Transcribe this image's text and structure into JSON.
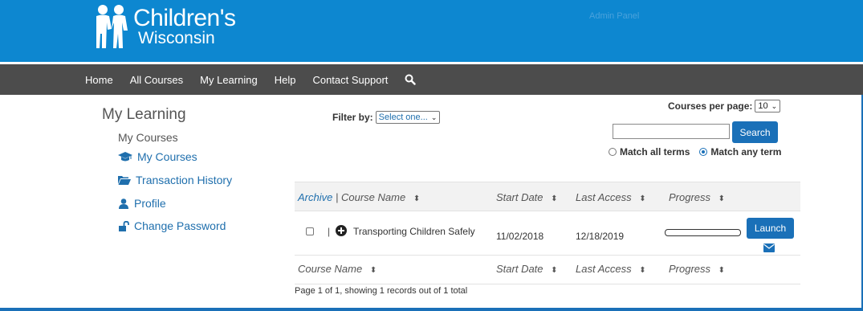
{
  "header": {
    "logo_line1": "Children's",
    "logo_line2": "Wisconsin",
    "admin_panel": "Admin Panel"
  },
  "nav": {
    "items": [
      "Home",
      "All Courses",
      "My Learning",
      "Help",
      "Contact Support"
    ],
    "search_icon": "search-icon"
  },
  "sidebar": {
    "title": "My Learning",
    "subtitle": "My Courses",
    "links": [
      {
        "label": "My Courses",
        "icon": "graduation-cap-icon"
      },
      {
        "label": "Transaction History",
        "icon": "folder-open-icon"
      },
      {
        "label": "Profile",
        "icon": "user-icon"
      },
      {
        "label": "Change Password",
        "icon": "unlock-icon"
      }
    ]
  },
  "filter": {
    "label": "Filter by:",
    "selected": "Select one..."
  },
  "per_page": {
    "label": "Courses per page:",
    "value": "10"
  },
  "search": {
    "value": "",
    "button": "Search",
    "match_all": "Match all terms",
    "match_any": "Match any term",
    "selected": "match_any"
  },
  "table": {
    "archive": "Archive",
    "sep": "|",
    "headers": {
      "course_name": "Course Name",
      "start_date": "Start Date",
      "last_access": "Last Access",
      "progress": "Progress"
    },
    "sort_glyph": "⬍",
    "rows": [
      {
        "sep": "|",
        "course_name": "Transporting Children Safely",
        "start_date": "11/02/2018",
        "last_access": "12/18/2019",
        "progress": 0,
        "button": "Launch"
      }
    ],
    "page_info": "Page 1 of 1, showing 1 records out of 1 total"
  },
  "colors": {
    "header_bg": "#0d87d0",
    "nav_bg": "#4c4c4c",
    "accent": "#1a70b8"
  }
}
